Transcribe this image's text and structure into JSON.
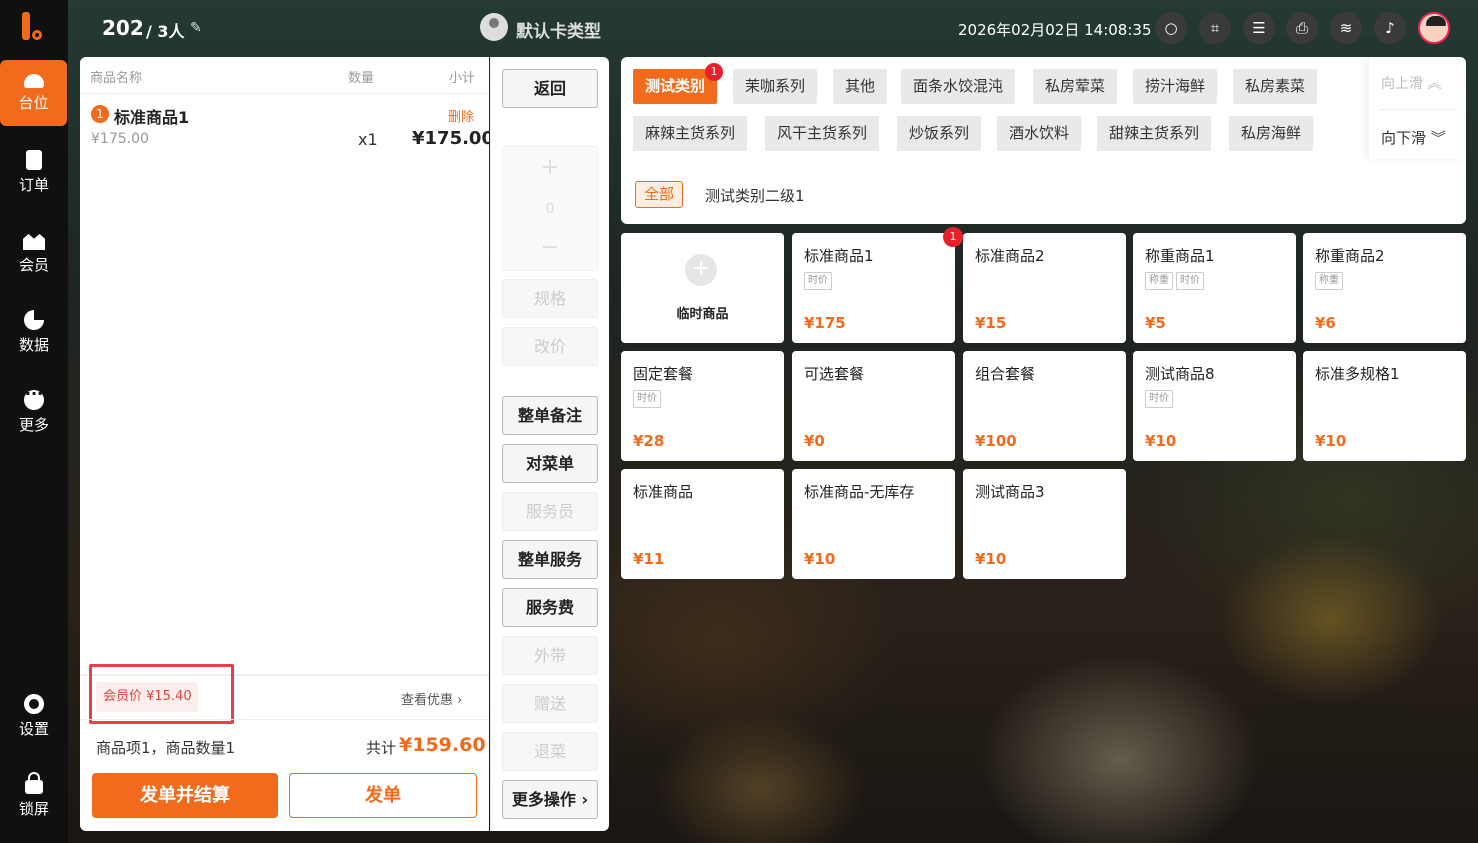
{
  "nav": {
    "items": [
      {
        "label": "台位",
        "icon": "table-icon"
      },
      {
        "label": "订单",
        "icon": "order-icon"
      },
      {
        "label": "会员",
        "icon": "crown-icon"
      },
      {
        "label": "数据",
        "icon": "pie-chart-icon"
      },
      {
        "label": "更多",
        "icon": "more-dots-icon"
      },
      {
        "label": "设置",
        "icon": "gear-icon"
      },
      {
        "label": "锁屏",
        "icon": "lock-icon"
      }
    ]
  },
  "topbar": {
    "table_no": "202",
    "people": "/ 3人",
    "card_type": "默认卡类型",
    "datetime": "2026年02月02日 14:08:35"
  },
  "order": {
    "headers": {
      "name": "商品名称",
      "qty": "数量",
      "subtotal": "小计"
    },
    "items": [
      {
        "index": "1",
        "name": "标准商品1",
        "delete": "删除",
        "price": "¥175.00",
        "qty": "x1",
        "subtotal": "¥175.00"
      }
    ],
    "member_price": "会员价 ¥15.40",
    "view_discount": "查看优惠 ›",
    "summary": "商品项1，商品数量1",
    "total_label": "共计",
    "total": "¥159.60",
    "settle_label": "发单并结算",
    "send_label": "发单"
  },
  "actions": {
    "back": "返回",
    "stepper_plus": "+",
    "stepper_value": "0",
    "stepper_minus": "−",
    "spec": "规格",
    "change_price": "改价",
    "order_note": "整单备注",
    "check_menu": "对菜单",
    "waiter": "服务员",
    "order_service": "整单服务",
    "service_fee": "服务费",
    "takeaway": "外带",
    "gift": "赠送",
    "return_dish": "退菜",
    "more_ops": "更多操作 ›"
  },
  "categories": {
    "items": [
      {
        "label": "测试类别",
        "badge": "1"
      },
      {
        "label": "茉咖系列"
      },
      {
        "label": "其他"
      },
      {
        "label": "面条水饺混沌"
      },
      {
        "label": "私房荤菜"
      },
      {
        "label": "捞汁海鲜"
      },
      {
        "label": "私房素菜"
      },
      {
        "label": "麻辣主货系列"
      },
      {
        "label": "风干主货系列"
      },
      {
        "label": "炒饭系列"
      },
      {
        "label": "酒水饮料"
      },
      {
        "label": "甜辣主货系列"
      },
      {
        "label": "私房海鲜"
      }
    ],
    "scroll_up": "向上滑 ︽",
    "scroll_down": "向下滑 ︾",
    "sub_all": "全部",
    "sub_cat": "测试类别二级1"
  },
  "products": {
    "temp": {
      "label": "临时商品",
      "plus": "+"
    },
    "items": [
      {
        "name": "标准商品1",
        "tags": [
          "时价"
        ],
        "price": "¥175",
        "badge": "1"
      },
      {
        "name": "标准商品2",
        "tags": [],
        "price": "¥15"
      },
      {
        "name": "称重商品1",
        "tags": [
          "称重",
          "时价"
        ],
        "price": "¥5"
      },
      {
        "name": "称重商品2",
        "tags": [
          "称重"
        ],
        "price": "¥6"
      },
      {
        "name": "固定套餐",
        "tags": [
          "时价"
        ],
        "price": "¥28"
      },
      {
        "name": "可选套餐",
        "tags": [],
        "price": "¥0"
      },
      {
        "name": "组合套餐",
        "tags": [],
        "price": "¥100"
      },
      {
        "name": "测试商品8",
        "tags": [
          "时价"
        ],
        "price": "¥10"
      },
      {
        "name": "标准多规格1",
        "tags": [],
        "price": "¥10"
      },
      {
        "name": "标准商品",
        "tags": [],
        "price": "¥11"
      },
      {
        "name": "标准商品-无库存",
        "tags": [],
        "price": "¥10"
      },
      {
        "name": "测试商品3",
        "tags": [],
        "price": "¥10"
      }
    ]
  },
  "colors": {
    "accent": "#f26a1b",
    "badge": "#e8202a",
    "highlight": "#e8404a"
  }
}
